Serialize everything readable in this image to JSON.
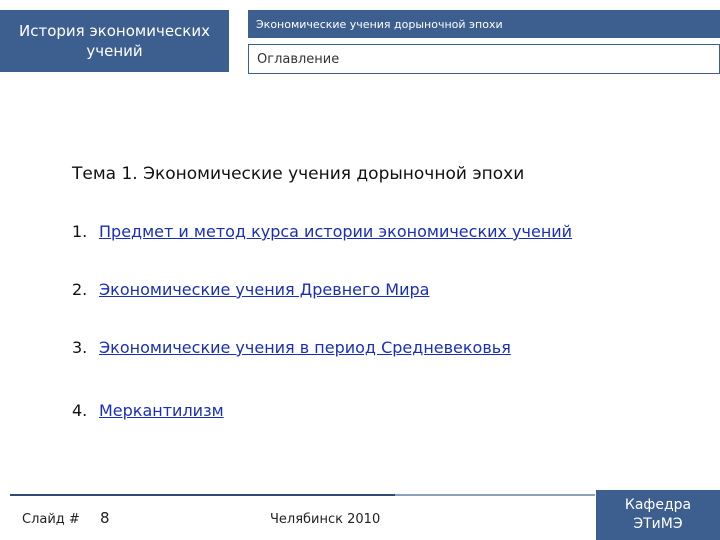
{
  "sidebar": {
    "title_line1": "История экономических",
    "title_line2": "учений"
  },
  "header": {
    "text": "Экономические учения дорыночной эпохи",
    "section": "Оглавление"
  },
  "topic": "Тема 1. Экономические учения дорыночной эпохи",
  "toc": [
    {
      "num": "1.",
      "label": "Предмет и метод курса истории экономических учений"
    },
    {
      "num": "2.",
      "label": "Экономические учения Древнего Мира"
    },
    {
      "num": "3.",
      "label": "Экономические учения в период  Средневековья"
    },
    {
      "num": "4.",
      "label": "Меркантилизм"
    }
  ],
  "footer": {
    "slide_label": "Слайд #",
    "slide_number": "8",
    "city_year": "Челябинск 2010",
    "dept_line1": "Кафедра",
    "dept_line2": "ЭТиМЭ"
  },
  "colors": {
    "accent": "#3d5f8f",
    "link": "#1a2fb8"
  }
}
